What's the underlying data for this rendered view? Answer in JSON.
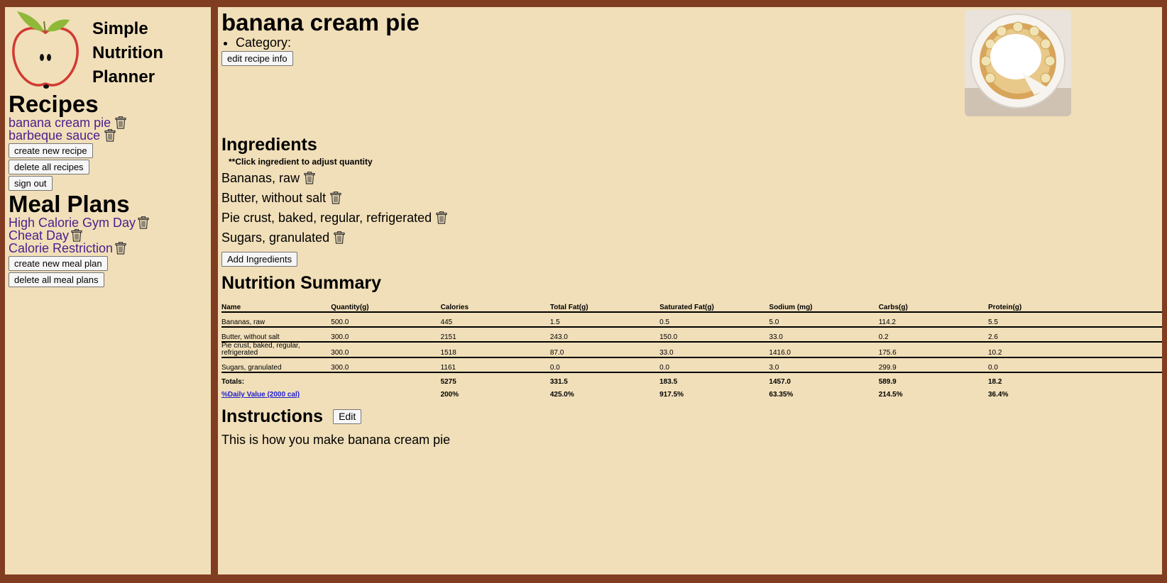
{
  "brand": {
    "title_lines": [
      "Simple",
      "Nutrition",
      "Planner"
    ]
  },
  "sidebar": {
    "recipes_heading": "Recipes",
    "recipes": [
      "banana cream pie",
      "barbeque sauce"
    ],
    "create_recipe": "create new recipe",
    "delete_recipes": "delete all recipes",
    "sign_out": "sign out",
    "mealplans_heading": "Meal Plans",
    "mealplans": [
      "High Calorie Gym Day",
      "Cheat Day",
      "Calorie Restriction"
    ],
    "create_mealplan": "create new meal plan",
    "delete_mealplans": "delete all meal plans"
  },
  "recipe": {
    "title": "banana cream pie",
    "category_label": "Category:",
    "edit_info": "edit recipe info"
  },
  "ingredients": {
    "heading": "Ingredients",
    "note": "**Click ingredient to adjust quantity",
    "items": [
      "Bananas, raw",
      "Butter, without salt",
      "Pie crust, baked, regular, refrigerated",
      "Sugars, granulated"
    ],
    "add_button": "Add Ingredients"
  },
  "nutrition": {
    "heading": "Nutrition Summary",
    "columns": [
      "Name",
      "Quantity(g)",
      "Calories",
      "Total Fat(g)",
      "Saturated Fat(g)",
      "Sodium (mg)",
      "Carbs(g)",
      "Protein(g)"
    ],
    "rows": [
      [
        "Bananas, raw",
        "500.0",
        "445",
        "1.5",
        "0.5",
        "5.0",
        "114.2",
        "5.5"
      ],
      [
        "Butter, without salt",
        "300.0",
        "2151",
        "243.0",
        "150.0",
        "33.0",
        "0.2",
        "2.6"
      ],
      [
        "Pie crust, baked, regular, refrigerated",
        "300.0",
        "1518",
        "87.0",
        "33.0",
        "1416.0",
        "175.6",
        "10.2"
      ],
      [
        "Sugars, granulated",
        "300.0",
        "1161",
        "0.0",
        "0.0",
        "3.0",
        "299.9",
        "0.0"
      ]
    ],
    "totals": [
      "Totals:",
      "",
      "5275",
      "331.5",
      "183.5",
      "1457.0",
      "589.9",
      "18.2"
    ],
    "daily": [
      "%Daily Value (2000 cal)",
      "",
      "200%",
      "425.0%",
      "917.5%",
      "63.35%",
      "214.5%",
      "36.4%"
    ]
  },
  "instructions": {
    "heading": "Instructions",
    "edit": "Edit",
    "text": "This is how you make banana cream pie"
  },
  "icons": {
    "trash": "trash-icon",
    "logo": "apple-logo-icon",
    "photo": "banana-cream-pie-photo"
  },
  "colors": {
    "frame": "#813d21",
    "panel": "#f1dfb9",
    "link": "#4b1e8c",
    "dv_link": "#1f1fd0"
  }
}
